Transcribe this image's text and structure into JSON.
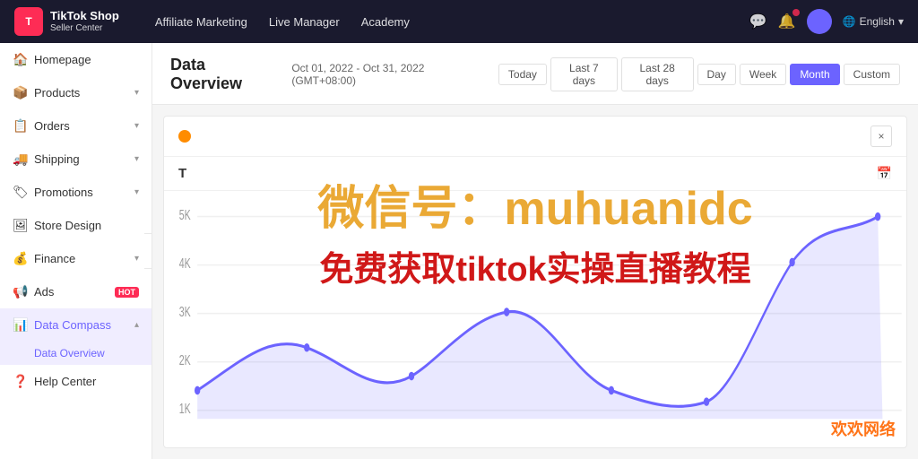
{
  "topnav": {
    "logo_title": "TikTok Shop",
    "logo_sub": "Seller Center",
    "logo_icon": "T",
    "nav_links": [
      {
        "label": "Affiliate Marketing",
        "id": "affiliate-marketing"
      },
      {
        "label": "Live Manager",
        "id": "live-manager"
      },
      {
        "label": "Academy",
        "id": "academy"
      }
    ],
    "lang_label": "English"
  },
  "sidebar": {
    "items": [
      {
        "id": "homepage",
        "label": "Homepage",
        "icon": "🏠",
        "has_chevron": false
      },
      {
        "id": "products",
        "label": "Products",
        "icon": "📦",
        "has_chevron": true
      },
      {
        "id": "orders",
        "label": "Orders",
        "icon": "📋",
        "has_chevron": true
      },
      {
        "id": "shipping",
        "label": "Shipping",
        "icon": "🚚",
        "has_chevron": true
      },
      {
        "id": "promotions",
        "label": "Promotions",
        "icon": "🏷",
        "has_chevron": true
      },
      {
        "id": "store-design",
        "label": "Store Design",
        "icon": "🖼",
        "has_chevron": false
      },
      {
        "id": "finance",
        "label": "Finance",
        "icon": "💰",
        "has_chevron": true
      },
      {
        "id": "ads",
        "label": "Ads",
        "hot": true,
        "icon": "📢",
        "has_chevron": false
      },
      {
        "id": "data-compass",
        "label": "Data Compass",
        "icon": "📊",
        "has_chevron": true,
        "active": true
      },
      {
        "id": "data-overview-sub",
        "label": "Data Overview",
        "is_sub": true
      },
      {
        "id": "help-center",
        "label": "Help Center",
        "icon": "❓",
        "has_chevron": false
      }
    ]
  },
  "main": {
    "page_title": "Data Overview",
    "date_range": "Oct 01, 2022 - Oct 31, 2022 (GMT+08:00)",
    "time_filters": [
      {
        "label": "Today",
        "id": "today",
        "active": false
      },
      {
        "label": "Last 7 days",
        "id": "last7",
        "active": false
      },
      {
        "label": "Last 28 days",
        "id": "last28",
        "active": false
      },
      {
        "label": "Day",
        "id": "day",
        "active": false
      },
      {
        "label": "Week",
        "id": "week",
        "active": false
      },
      {
        "label": "Month",
        "id": "month",
        "active": true
      },
      {
        "label": "Custom",
        "id": "custom",
        "active": false
      }
    ],
    "chart": {
      "metric_label": "T",
      "y_labels": [
        "5K",
        "4K",
        "3K",
        "2K",
        "1K"
      ],
      "close_button": "×"
    },
    "watermark1": "微信号：muhuanidc",
    "watermark2": "免费获取tiktok实操直播教程",
    "watermark3": "欢欢网络"
  }
}
